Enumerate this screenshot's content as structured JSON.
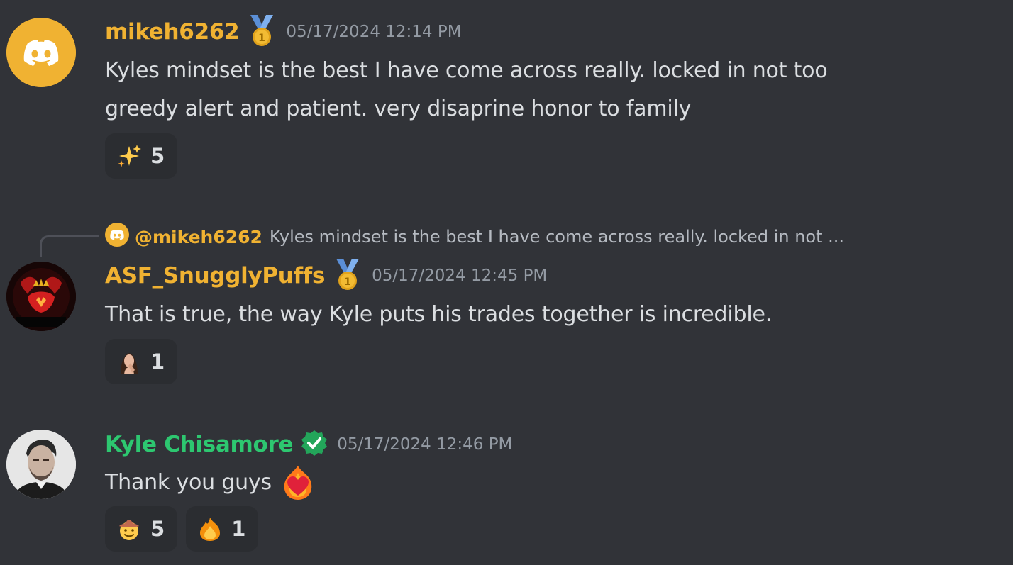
{
  "messages": [
    {
      "username": "mikeh6262",
      "username_color": "#f0b232",
      "avatar_icon": "discord-logo-icon",
      "badge_icon": "gold-medal-icon",
      "timestamp": "05/17/2024 12:14 PM",
      "content_line1": "Kyles mindset is the best I have come across really. locked in not too",
      "content_line2": "greedy alert and patient. very disaprine honor to family",
      "reactions": [
        {
          "emoji_icon": "sparkles-icon",
          "count": "5"
        }
      ]
    },
    {
      "reply": {
        "mention": "@mikeh6262",
        "text": "Kyles mindset is the best I have come across really. locked in not ..."
      },
      "username": "ASF_SnugglyPuffs",
      "username_color": "#f0b232",
      "avatar_icon": "red-dragon-avatar-icon",
      "badge_icon": "gold-medal-icon",
      "timestamp": "05/17/2024 12:45 PM",
      "content_line1": "That is true, the way Kyle puts his trades together is incredible.",
      "reactions": [
        {
          "emoji_icon": "custom-person-emoji-icon",
          "count": "1"
        }
      ]
    },
    {
      "username": "Kyle Chisamore",
      "username_color": "#2dc770",
      "avatar_icon": "photo-avatar-icon",
      "badge_icon": "verified-check-icon",
      "timestamp": "05/17/2024 12:46 PM",
      "content_line1": "Thank you guys",
      "content_emoji_icon": "heart-on-fire-icon",
      "reactions": [
        {
          "emoji_icon": "cowboy-face-icon",
          "count": "5"
        },
        {
          "emoji_icon": "fire-icon",
          "count": "1"
        }
      ]
    }
  ],
  "colors": {
    "background": "#313338",
    "reaction_bg": "#2b2d31",
    "timestamp": "#949ba4",
    "text": "#dbdee1",
    "discord_orange": "#f0b232"
  }
}
